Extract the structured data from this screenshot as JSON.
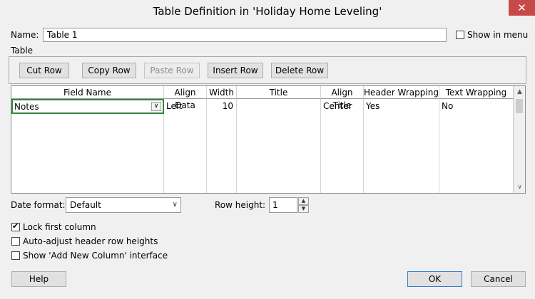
{
  "window": {
    "title": "Table Definition in 'Holiday Home Leveling'",
    "close_glyph": "✕"
  },
  "name": {
    "label": "Name:",
    "value": "Table 1"
  },
  "show_in_menu": {
    "label": "Show in menu",
    "checked": false
  },
  "table_group": {
    "label": "Table",
    "buttons": {
      "cut_row": "Cut Row",
      "copy_row": "Copy Row",
      "paste_row": "Paste Row",
      "insert_row": "Insert Row",
      "delete_row": "Delete Row"
    }
  },
  "grid": {
    "headers": [
      "Field Name",
      "Align Data",
      "Width",
      "Title",
      "Align Title",
      "Header Wrapping",
      "Text Wrapping"
    ],
    "rows": [
      {
        "field_name": "Notes",
        "align_data": "Left",
        "width": "10",
        "title": "",
        "align_title": "Center",
        "header_wrapping": "Yes",
        "text_wrapping": "No"
      }
    ],
    "dropdown_glyph": "∨",
    "scroll_up_glyph": "▲",
    "scroll_down_glyph": "∨"
  },
  "date_format": {
    "label": "Date format:",
    "value": "Default",
    "caret": "∨"
  },
  "row_height": {
    "label": "Row height:",
    "value": "1",
    "up": "▲",
    "down": "▼"
  },
  "options": {
    "lock_first_column": {
      "label": "Lock first column",
      "checked": true
    },
    "auto_adjust": {
      "label": "Auto-adjust header row heights",
      "checked": false
    },
    "show_add_new_column": {
      "label": "Show 'Add New Column' interface",
      "checked": false
    }
  },
  "footer": {
    "help": "Help",
    "ok": "OK",
    "cancel": "Cancel"
  }
}
